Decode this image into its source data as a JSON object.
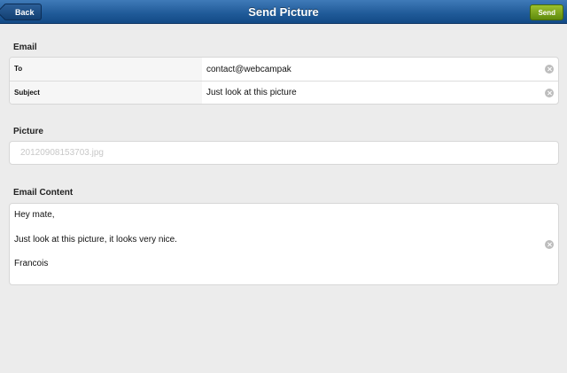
{
  "navbar": {
    "title": "Send Picture",
    "back_label": "Back",
    "send_label": "Send"
  },
  "email_section": {
    "label": "Email",
    "to_label": "To",
    "to_value": "contact@webcampak",
    "subject_label": "Subject",
    "subject_value": "Just look at this picture"
  },
  "picture_section": {
    "label": "Picture",
    "filename": "20120908153703.jpg"
  },
  "content_section": {
    "label": "Email Content",
    "lines": [
      "Hey mate,",
      "Just look at this picture, it looks very nice.",
      "Francois"
    ]
  },
  "icons": {
    "clear": "clear-circle-x-icon",
    "back": "back-arrow-button"
  },
  "colors": {
    "navbar": "#1f5a98",
    "send_button": "#7aa51c",
    "background": "#ececec"
  }
}
